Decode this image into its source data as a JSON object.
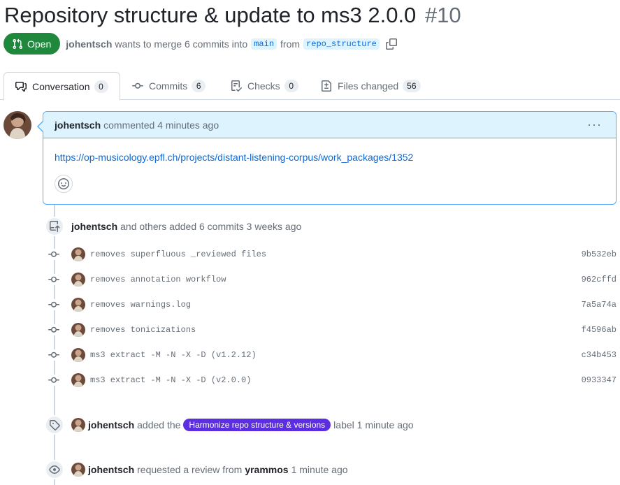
{
  "pr": {
    "title": "Repository structure & update to ms3 2.0.0",
    "number": "#10",
    "state": "Open",
    "author": "johentsch",
    "merge_text": "wants to merge 6 commits into",
    "base_branch": "main",
    "from_text": "from",
    "head_branch": "repo_structure"
  },
  "tabs": [
    {
      "label": "Conversation",
      "count": "0"
    },
    {
      "label": "Commits",
      "count": "6"
    },
    {
      "label": "Checks",
      "count": "0"
    },
    {
      "label": "Files changed",
      "count": "56"
    }
  ],
  "comment": {
    "author": "johentsch",
    "action": "commented 4 minutes ago",
    "menu": "···",
    "link": "https://op-musicology.epfl.ch/projects/distant-listening-corpus/work_packages/1352"
  },
  "commits_event": {
    "author": "johentsch",
    "text": "and others added 6 commits 3 weeks ago"
  },
  "commits": [
    {
      "message": "removes superfluous _reviewed files",
      "sha": "9b532eb"
    },
    {
      "message": "removes annotation workflow",
      "sha": "962cffd"
    },
    {
      "message": "removes warnings.log",
      "sha": "7a5a74a"
    },
    {
      "message": "removes tonicizations",
      "sha": "f4596ab"
    },
    {
      "message": "ms3 extract -M -N -X -D (v1.2.12)",
      "sha": "c34b453"
    },
    {
      "message": "ms3 extract -M -N -X -D (v2.0.0)",
      "sha": "0933347"
    }
  ],
  "label_event": {
    "author": "johentsch",
    "prefix": "added the",
    "label": "Harmonize repo structure & versions",
    "suffix": "label 1 minute ago"
  },
  "review_event": {
    "author": "johentsch",
    "text": "requested a review from",
    "reviewer": "yrammos",
    "time": "1 minute ago"
  },
  "colors": {
    "open_green": "#1f883d",
    "link_blue": "#0969da",
    "label_purple": "#5b2fe0",
    "comment_header": "#ddf4ff"
  },
  "icons": [
    "git-pull-request-icon",
    "copy-icon",
    "comment-discussion-icon",
    "git-commit-icon",
    "checklist-icon",
    "file-diff-icon",
    "kebab-horizontal-icon",
    "smiley-icon",
    "repo-push-icon",
    "tag-icon",
    "eye-icon"
  ]
}
